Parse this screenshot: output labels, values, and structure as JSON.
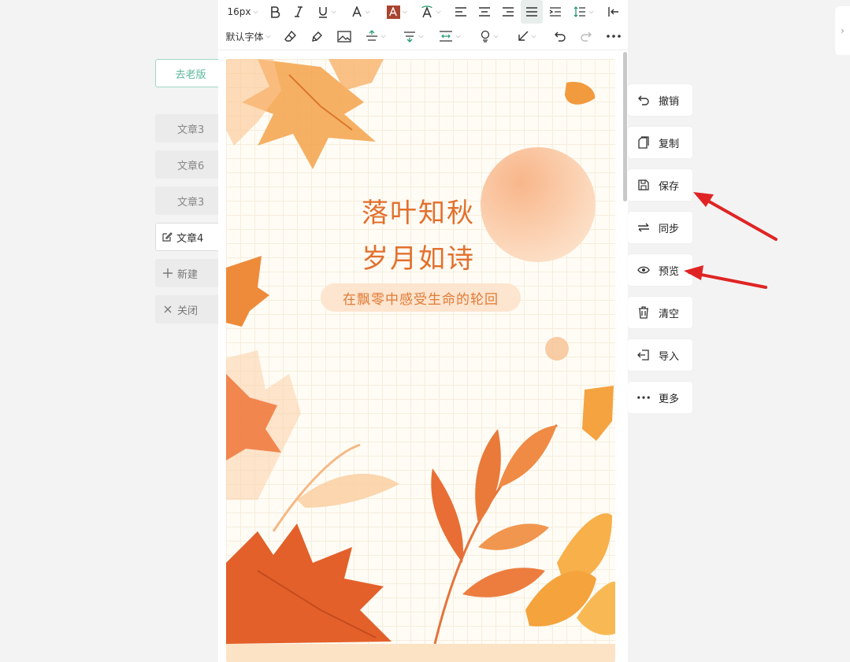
{
  "sidebar": {
    "old_version_label": "去老版",
    "articles": [
      {
        "label": "文章3"
      },
      {
        "label": "文章6"
      },
      {
        "label": "文章3"
      },
      {
        "label": "文章4"
      }
    ],
    "new_label": "新建",
    "close_label": "关闭"
  },
  "toolbar": {
    "font_size": "16px",
    "font_family": "默认字体"
  },
  "poster": {
    "title_line1": "落叶知秋",
    "title_line2": "岁月如诗",
    "subtitle": "在飘零中感受生命的轮回",
    "accent_color": "#e2702d"
  },
  "actions": [
    {
      "label": "撤销",
      "icon": "undo-icon"
    },
    {
      "label": "复制",
      "icon": "copy-icon"
    },
    {
      "label": "保存",
      "icon": "save-icon"
    },
    {
      "label": "同步",
      "icon": "sync-icon"
    },
    {
      "label": "预览",
      "icon": "eye-icon"
    },
    {
      "label": "清空",
      "icon": "trash-icon"
    },
    {
      "label": "导入",
      "icon": "import-icon"
    },
    {
      "label": "更多",
      "icon": "more-icon"
    }
  ],
  "annotation_color": "#e02424"
}
